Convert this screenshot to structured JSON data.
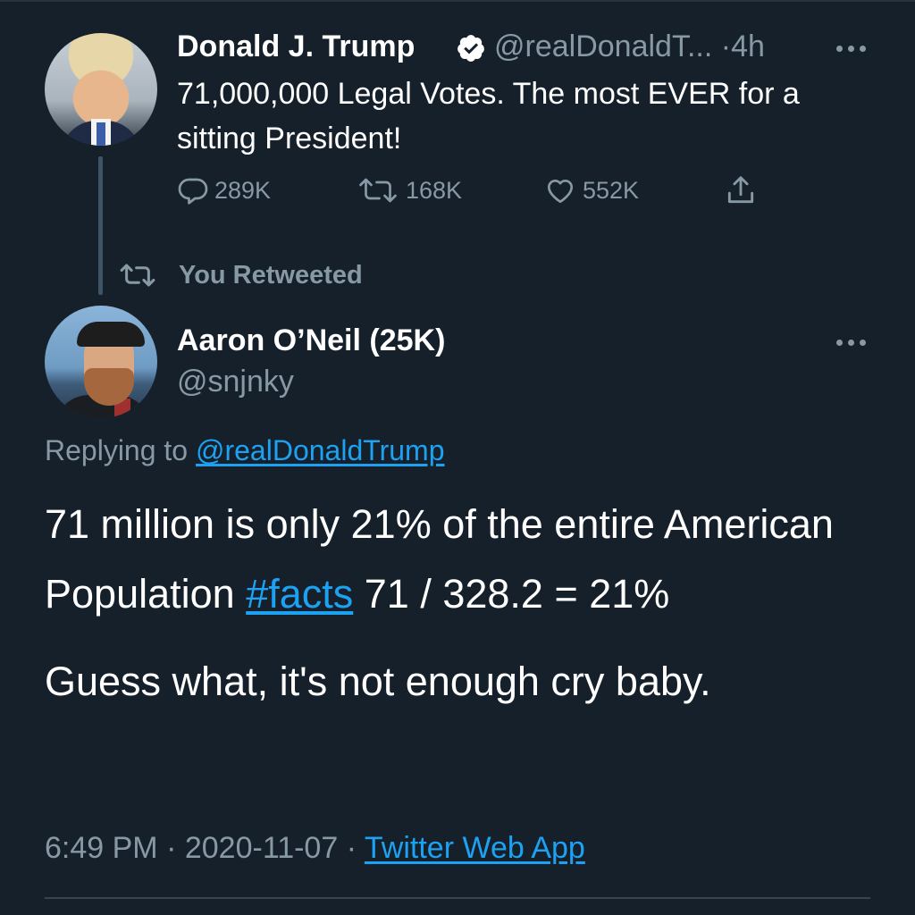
{
  "parent_tweet": {
    "author_name": "Donald J. Trump",
    "handle": "@realDonaldT...",
    "separator": "·",
    "time": "4h",
    "text": "71,000,000 Legal Votes. The most EVER for a sitting President!",
    "actions": {
      "reply_count": "289K",
      "retweet_count": "168K",
      "like_count": "552K"
    }
  },
  "retweet_notice": "You Retweeted",
  "main_tweet": {
    "author_name": "Aaron O’Neil (25K)",
    "handle": "@snjnky",
    "replying_prefix": "Replying to",
    "replying_handle": "@realDonaldTrump",
    "text_part1": "71 million is only 21% of the entire American Population",
    "hashtag": "#facts",
    "text_part2": "71 / 328.2 = 21%",
    "text_para2": "Guess what, it's not enough cry baby.",
    "time": "6:49 PM",
    "date": "2020-11-07",
    "meta_separator": "·",
    "source": "Twitter Web App"
  },
  "colors": {
    "background": "#15202b",
    "text_primary": "#ffffff",
    "text_secondary": "#8899a6",
    "accent": "#1da1f2",
    "thread_line": "#3d5466",
    "divider": "#38444d"
  },
  "icons": [
    "verified-icon",
    "more-icon",
    "reply-icon",
    "retweet-icon",
    "like-icon",
    "share-icon"
  ]
}
